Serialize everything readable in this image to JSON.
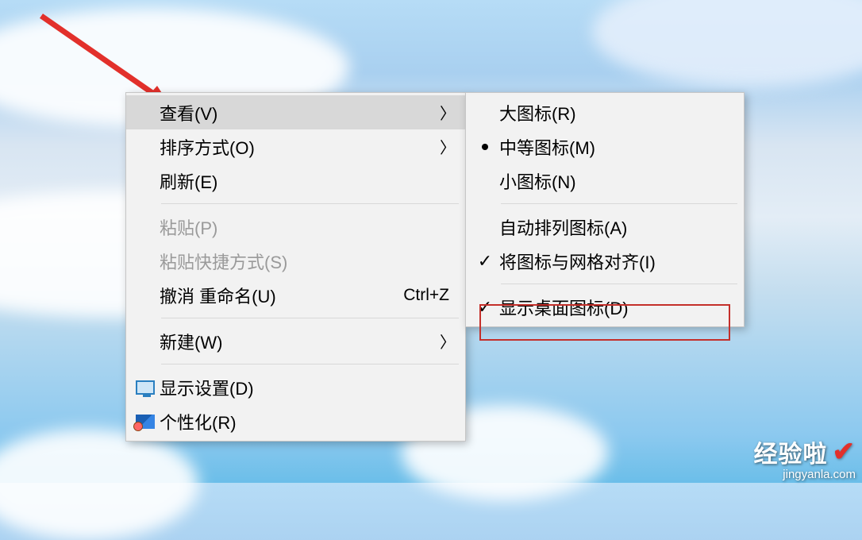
{
  "main_menu": {
    "view": {
      "label": "查看(V)"
    },
    "sort": {
      "label": "排序方式(O)"
    },
    "refresh": {
      "label": "刷新(E)"
    },
    "paste": {
      "label": "粘贴(P)"
    },
    "paste_shortcut": {
      "label": "粘贴快捷方式(S)"
    },
    "undo": {
      "label": "撤消 重命名(U)",
      "shortcut": "Ctrl+Z"
    },
    "new": {
      "label": "新建(W)"
    },
    "display_settings": {
      "label": "显示设置(D)"
    },
    "personalize": {
      "label": "个性化(R)"
    }
  },
  "sub_menu": {
    "large_icons": {
      "label": "大图标(R)"
    },
    "medium_icons": {
      "label": "中等图标(M)"
    },
    "small_icons": {
      "label": "小图标(N)"
    },
    "auto_arrange": {
      "label": "自动排列图标(A)"
    },
    "align_grid": {
      "label": "将图标与网格对齐(I)"
    },
    "show_desktop_icons": {
      "label": "显示桌面图标(D)"
    }
  },
  "watermark": {
    "text": "经验啦",
    "url": "jingyanla.com"
  },
  "glyphs": {
    "chevron_right": "〉",
    "check": "✓"
  }
}
